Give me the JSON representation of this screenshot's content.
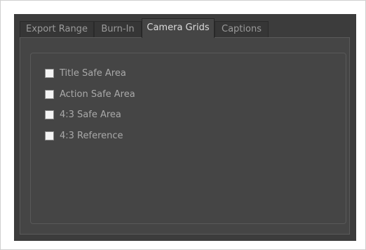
{
  "tabs": [
    {
      "label": "Export Range",
      "active": false
    },
    {
      "label": "Burn-In",
      "active": false
    },
    {
      "label": "Camera Grids",
      "active": true
    },
    {
      "label": "Captions",
      "active": false
    }
  ],
  "camera_grids": {
    "options": [
      {
        "label": "Title Safe Area",
        "checked": false
      },
      {
        "label": "Action Safe Area",
        "checked": false
      },
      {
        "label": "4:3 Safe Area",
        "checked": false
      },
      {
        "label": "4:3 Reference",
        "checked": false
      }
    ]
  },
  "colors": {
    "panel_background": "#3c3c3c",
    "tab_content_background": "#454545",
    "checkbox_fill": "#f4f4f4",
    "label_text": "#a9a9a9"
  }
}
